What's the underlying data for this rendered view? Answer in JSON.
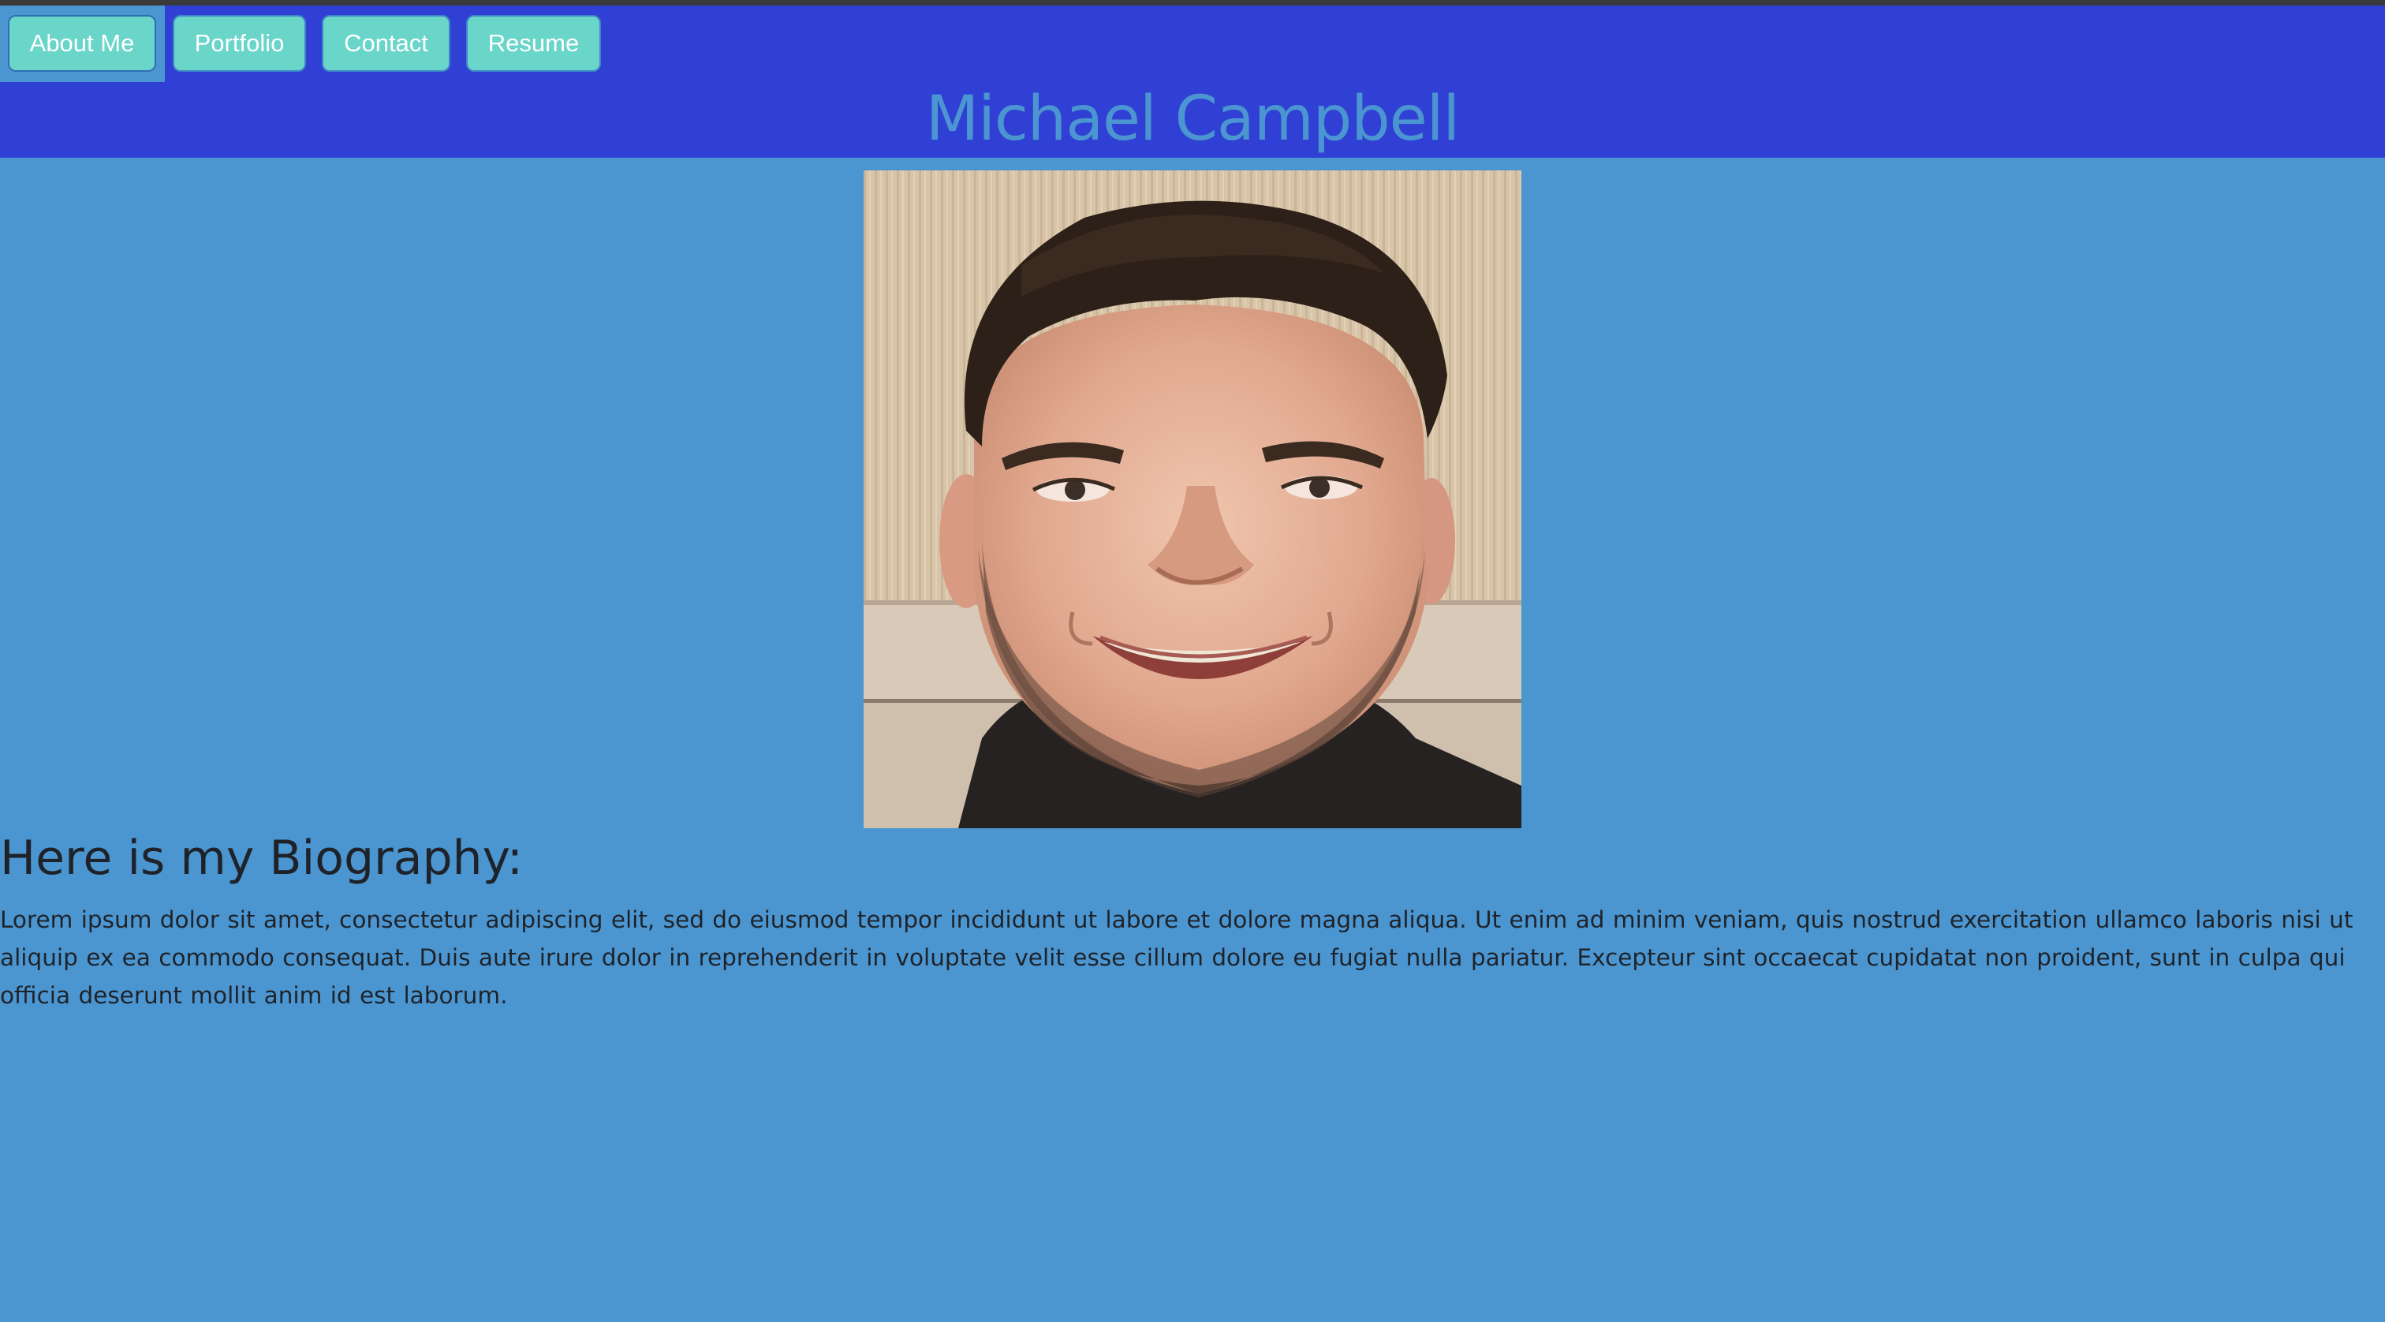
{
  "nav": {
    "items": [
      {
        "label": "About Me",
        "active": true
      },
      {
        "label": "Portfolio",
        "active": false
      },
      {
        "label": "Contact",
        "active": false
      },
      {
        "label": "Resume",
        "active": false
      }
    ]
  },
  "header": {
    "title": "Michael Campbell"
  },
  "profile": {
    "photo_icon": "profile-photo"
  },
  "bio": {
    "heading": "Here is my Biography:",
    "text": "Lorem ipsum dolor sit amet, consectetur adipiscing elit, sed do eiusmod tempor incididunt ut labore et dolore magna aliqua. Ut enim ad minim veniam, quis nostrud exercitation ullamco laboris nisi ut aliquip ex ea commodo consequat. Duis aute irure dolor in reprehenderit in voluptate velit esse cillum dolore eu fugiat nulla pariatur. Excepteur sint occaecat cupidatat non proident, sunt in culpa qui officia deserunt mollit anim id est laborum."
  },
  "colors": {
    "page_background": "#4b96d1",
    "header_background": "#3140d4",
    "button_background": "#6ad5c9",
    "title_color": "#4b96d1",
    "text_color": "#1f2329"
  }
}
